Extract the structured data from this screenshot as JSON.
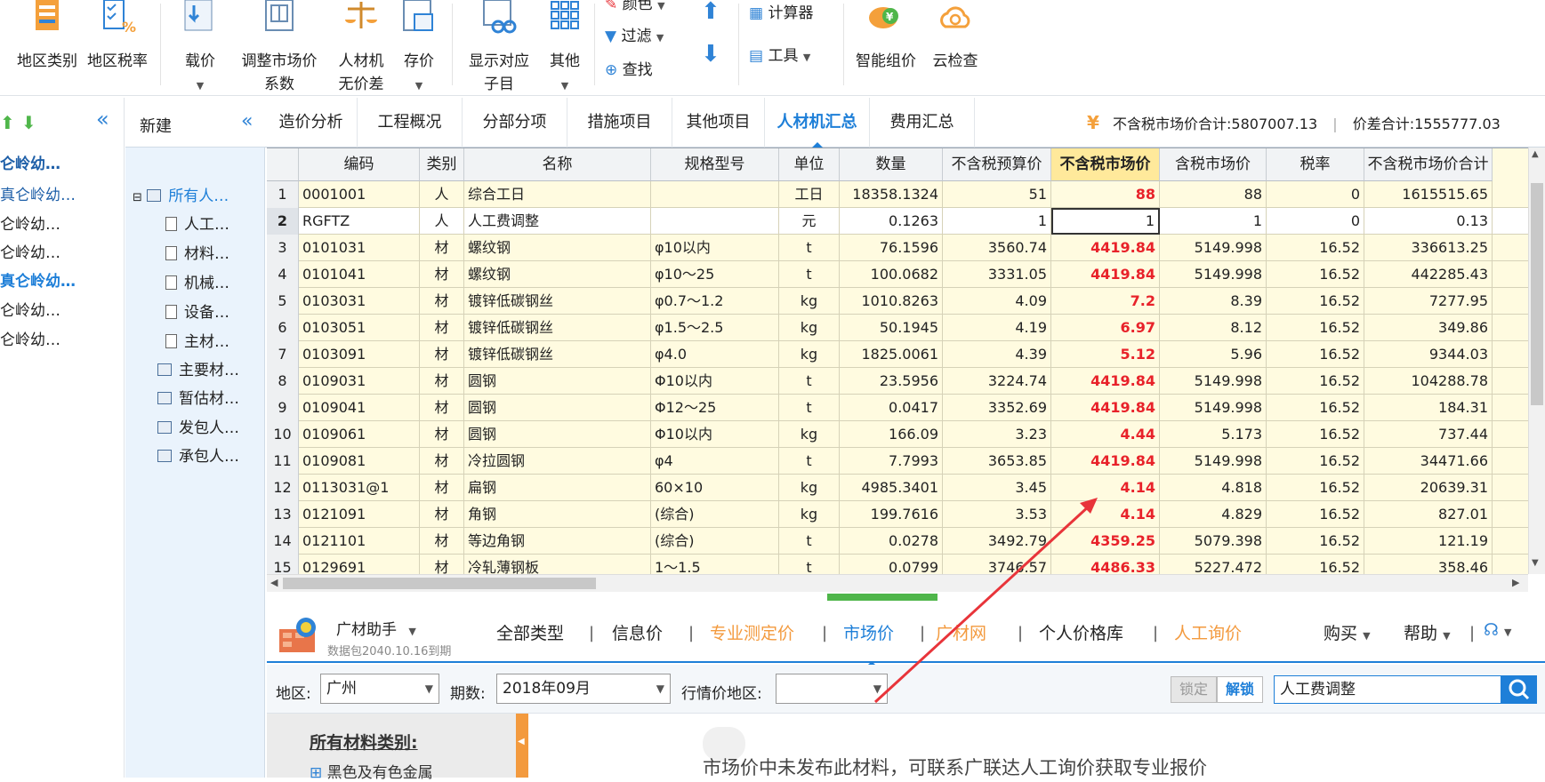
{
  "ribbon": {
    "region_type": "地区类别",
    "region_tax": "地区税率",
    "price_cut": "载价",
    "adjust_market_l1": "调整市场价",
    "adjust_market_l2": "系数",
    "rcj_l1": "人材机",
    "rcj_l2": "无价差",
    "save_price": "存价",
    "show_sub_l1": "显示对应",
    "show_sub_l2": "子目",
    "other": "其他",
    "color": "颜色",
    "filter": "过滤",
    "find": "查找",
    "calculator": "计算器",
    "tools": "工具",
    "smart_price": "智能组价",
    "cloud_check": "云检查"
  },
  "left_items": [
    "仑岭幼…",
    "真仑岭幼…",
    "仑岭幼…",
    "仑岭幼…",
    "真仑岭幼…",
    "仑岭幼…",
    "仑岭幼…"
  ],
  "tree": {
    "new_label": "新建",
    "root": "所有人…",
    "children": [
      "人工…",
      "材料…",
      "机械…",
      "设备…",
      "主材…"
    ],
    "groups": [
      "主要材…",
      "暂估材…",
      "发包人…",
      "承包人…"
    ]
  },
  "tabs": [
    "造价分析",
    "工程概况",
    "分部分项",
    "措施项目",
    "其他项目",
    "人材机汇总",
    "费用汇总"
  ],
  "active_tab": 5,
  "summary": {
    "market_total_label": "不含税市场价合计:",
    "market_total": "5807007.13",
    "diff_total_label": "价差合计:",
    "diff_total": "1555777.03"
  },
  "columns": [
    "",
    "编码",
    "类别",
    "名称",
    "规格型号",
    "单位",
    "数量",
    "不含税预算价",
    "不含税市场价",
    "含税市场价",
    "税率",
    "不含税市场价合计"
  ],
  "rows": [
    [
      "1",
      "0001001",
      "人",
      "综合工日",
      "",
      "工日",
      "18358.1324",
      "51",
      "88",
      "88",
      "0",
      "1615515.65"
    ],
    [
      "2",
      "RGFTZ",
      "人",
      "人工费调整",
      "",
      "元",
      "0.1263",
      "1",
      "1",
      "1",
      "0",
      "0.13"
    ],
    [
      "3",
      "0101031",
      "材",
      "螺纹钢",
      "φ10以内",
      "t",
      "76.1596",
      "3560.74",
      "4419.84",
      "5149.998",
      "16.52",
      "336613.25"
    ],
    [
      "4",
      "0101041",
      "材",
      "螺纹钢",
      "φ10～25",
      "t",
      "100.0682",
      "3331.05",
      "4419.84",
      "5149.998",
      "16.52",
      "442285.43"
    ],
    [
      "5",
      "0103031",
      "材",
      "镀锌低碳钢丝",
      "φ0.7～1.2",
      "kg",
      "1010.8263",
      "4.09",
      "7.2",
      "8.39",
      "16.52",
      "7277.95"
    ],
    [
      "6",
      "0103051",
      "材",
      "镀锌低碳钢丝",
      "φ1.5～2.5",
      "kg",
      "50.1945",
      "4.19",
      "6.97",
      "8.12",
      "16.52",
      "349.86"
    ],
    [
      "7",
      "0103091",
      "材",
      "镀锌低碳钢丝",
      "φ4.0",
      "kg",
      "1825.0061",
      "4.39",
      "5.12",
      "5.96",
      "16.52",
      "9344.03"
    ],
    [
      "8",
      "0109031",
      "材",
      "圆钢",
      "Φ10以内",
      "t",
      "23.5956",
      "3224.74",
      "4419.84",
      "5149.998",
      "16.52",
      "104288.78"
    ],
    [
      "9",
      "0109041",
      "材",
      "圆钢",
      "Φ12～25",
      "t",
      "0.0417",
      "3352.69",
      "4419.84",
      "5149.998",
      "16.52",
      "184.31"
    ],
    [
      "10",
      "0109061",
      "材",
      "圆钢",
      "Φ10以内",
      "kg",
      "166.09",
      "3.23",
      "4.44",
      "5.173",
      "16.52",
      "737.44"
    ],
    [
      "11",
      "0109081",
      "材",
      "冷拉圆钢",
      "φ4",
      "t",
      "7.7993",
      "3653.85",
      "4419.84",
      "5149.998",
      "16.52",
      "34471.66"
    ],
    [
      "12",
      "0113031@1",
      "材",
      "扁钢",
      "60×10",
      "kg",
      "4985.3401",
      "3.45",
      "4.14",
      "4.818",
      "16.52",
      "20639.31"
    ],
    [
      "13",
      "0121091",
      "材",
      "角钢",
      "(综合)",
      "kg",
      "199.7616",
      "3.53",
      "4.14",
      "4.829",
      "16.52",
      "827.01"
    ],
    [
      "14",
      "0121101",
      "材",
      "等边角钢",
      "(综合)",
      "t",
      "0.0278",
      "3492.79",
      "4359.25",
      "5079.398",
      "16.52",
      "121.19"
    ],
    [
      "15",
      "0129691",
      "材",
      "冷轧薄钢板",
      "1～1.5",
      "t",
      "0.0799",
      "3746.57",
      "4486.33",
      "5227.472",
      "16.52",
      "358.46"
    ]
  ],
  "helper": {
    "title": "广材助手",
    "subtitle": "数据包2040.10.16到期",
    "links": [
      "全部类型",
      "信息价",
      "专业测定价",
      "市场价",
      "广材网",
      "个人价格库",
      "人工询价"
    ],
    "buy": "购买",
    "help": "帮助"
  },
  "filter": {
    "region_label": "地区:",
    "region_value": "广州",
    "period_label": "期数:",
    "period_value": "2018年09月",
    "market_region_label": "行情价地区:",
    "market_region_value": "",
    "lock": "锁定",
    "unlock": "解锁",
    "search_value": "人工费调整"
  },
  "category_title": "所有材料类别:",
  "category_first": "黑色及有色金属",
  "message": "市场价中未发布此材料，可联系广联达人工询价获取专业报价",
  "colors": {
    "accent": "#1e7fd8",
    "highlight_header": "#ffe99b",
    "red_value": "#e8222a",
    "row_bg": "#fffbe0",
    "annotation_arrow": "#e8343a"
  }
}
